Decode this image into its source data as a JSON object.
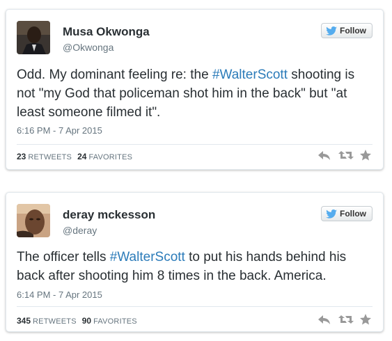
{
  "tweets": [
    {
      "name": "Musa Okwonga",
      "handle": "@Okwonga",
      "follow_label": "Follow",
      "text_before": "Odd. My dominant feeling re: the ",
      "hashtag": "#WalterScott",
      "text_after": " shooting is not \"my God that policeman shot him in the back\" but \"at least someone filmed it\".",
      "timestamp": "6:16 PM - 7 Apr 2015",
      "retweets_count": "23",
      "retweets_label": "RETWEETS",
      "favorites_count": "24",
      "favorites_label": "FAVORITES",
      "icons": [
        "twitter-bird-icon",
        "reply-icon",
        "retweet-icon",
        "favorite-star-icon"
      ]
    },
    {
      "name": "deray mckesson",
      "handle": "@deray",
      "follow_label": "Follow",
      "text_before": "The officer tells ",
      "hashtag": "#WalterScott",
      "text_after": " to put his hands behind his back after shooting him 8 times in the back. America.",
      "timestamp": "6:14 PM - 7 Apr 2015",
      "retweets_count": "345",
      "retweets_label": "RETWEETS",
      "favorites_count": "90",
      "favorites_label": "FAVORITES",
      "icons": [
        "twitter-bird-icon",
        "reply-icon",
        "retweet-icon",
        "favorite-star-icon"
      ]
    }
  ],
  "colors": {
    "hashtag": "#2b7bb9",
    "twitter_blue": "#55acee",
    "text": "#292f33",
    "muted": "#66757f",
    "border": "#e1e8ed",
    "action_icon": "#999999"
  }
}
